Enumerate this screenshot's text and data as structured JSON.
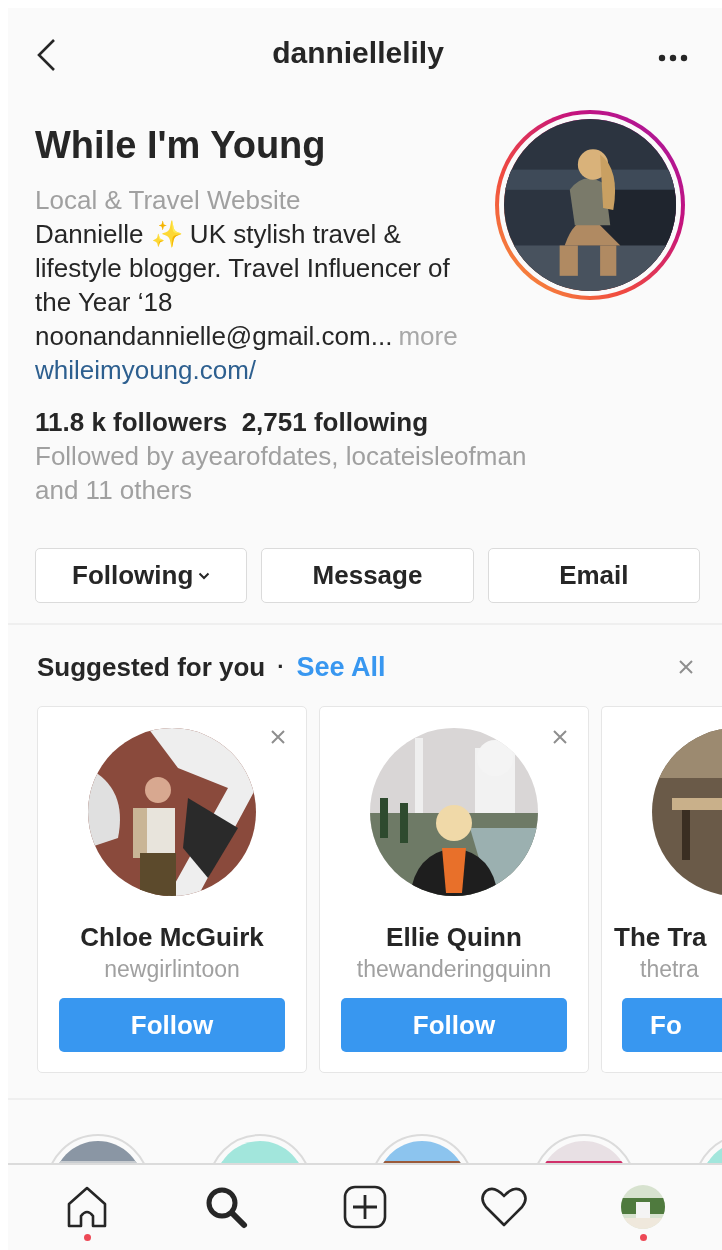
{
  "header": {
    "title": "danniellelily"
  },
  "profile": {
    "name": "While I'm Young",
    "category": "Local & Travel Website",
    "bio": "Dannielle ✨ UK stylish travel & lifestyle blogger. Travel Influencer of the Year ‘18",
    "email": "noonandannielle@gmail.com...",
    "more": "more",
    "link": "whileimyoung.com/",
    "story_ring": true,
    "stats": "11.8 k followers  2,751 following",
    "followed_by": "Followed by ayearofdates, locateisleofman and 11 others"
  },
  "actions": [
    {
      "label": "Following",
      "dropdown": true
    },
    {
      "label": "Message",
      "dropdown": false
    },
    {
      "label": "Email",
      "dropdown": false
    }
  ],
  "suggested": {
    "title": "Suggested for you",
    "separator": "·",
    "see_all": "See All",
    "cards": [
      {
        "kind": "full",
        "name": "Chloe McGuirk",
        "username": "newgirlintoon",
        "button": "Follow"
      },
      {
        "kind": "full",
        "name": "Ellie Quinn",
        "username": "thewanderingquinn",
        "button": "Follow"
      },
      {
        "kind": "partial",
        "name": "The Tra",
        "username": "thetra",
        "button": "Fo"
      }
    ]
  },
  "nav": [
    {
      "kind": "home",
      "selected": false,
      "dot": true
    },
    {
      "kind": "search",
      "selected": true,
      "dot": false
    },
    {
      "kind": "add",
      "selected": false,
      "dot": false
    },
    {
      "kind": "heart",
      "selected": false,
      "dot": false
    },
    {
      "kind": "profile",
      "selected": false,
      "dot": true
    }
  ]
}
